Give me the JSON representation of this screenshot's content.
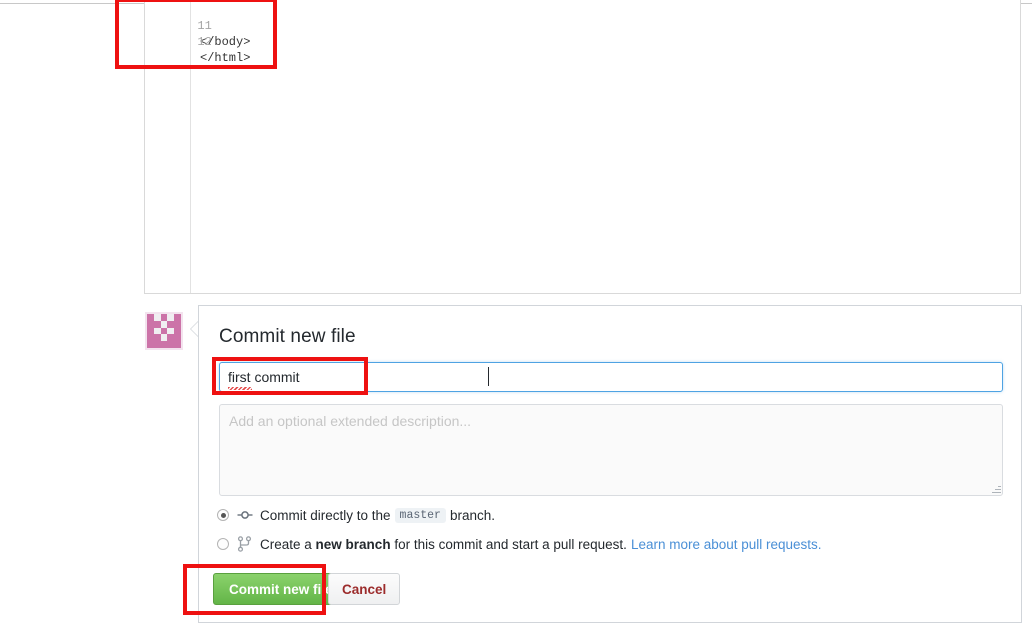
{
  "editor": {
    "lines": [
      {
        "number": "11",
        "code": "</body>"
      },
      {
        "number": "12",
        "code": "</html>"
      }
    ]
  },
  "avatar": {
    "icon_name": "user-identicon",
    "color": "#cc73a8",
    "background": "#f0eef1",
    "pattern": [
      [
        1,
        0,
        1,
        0,
        1
      ],
      [
        1,
        1,
        0,
        1,
        1
      ],
      [
        1,
        0,
        1,
        0,
        1
      ],
      [
        1,
        1,
        0,
        1,
        1
      ],
      [
        1,
        1,
        1,
        1,
        1
      ]
    ]
  },
  "commit": {
    "title": "Commit new file",
    "summary_value": "first commit",
    "summary_placeholder": "",
    "description_value": "",
    "description_placeholder": "Add an optional extended description...",
    "options": [
      {
        "id": "commit-directly",
        "icon_name": "git-commit-icon",
        "selected": true,
        "text_before": "Commit directly to the",
        "badge": "master",
        "text_after": "branch.",
        "strong": "",
        "link": ""
      },
      {
        "id": "create-new-branch",
        "icon_name": "git-branch-icon",
        "selected": false,
        "text_before": "Create a",
        "strong": "new branch",
        "text_after": "for this commit and start a pull request.",
        "badge": "",
        "link": "Learn more about pull requests."
      }
    ],
    "submit_label": "Commit new file",
    "cancel_label": "Cancel"
  },
  "colors": {
    "accent_green": "#63b548",
    "focus_blue": "#4fa3e3",
    "annotation_red": "#ee1111",
    "link_blue": "#4a8fd6"
  }
}
